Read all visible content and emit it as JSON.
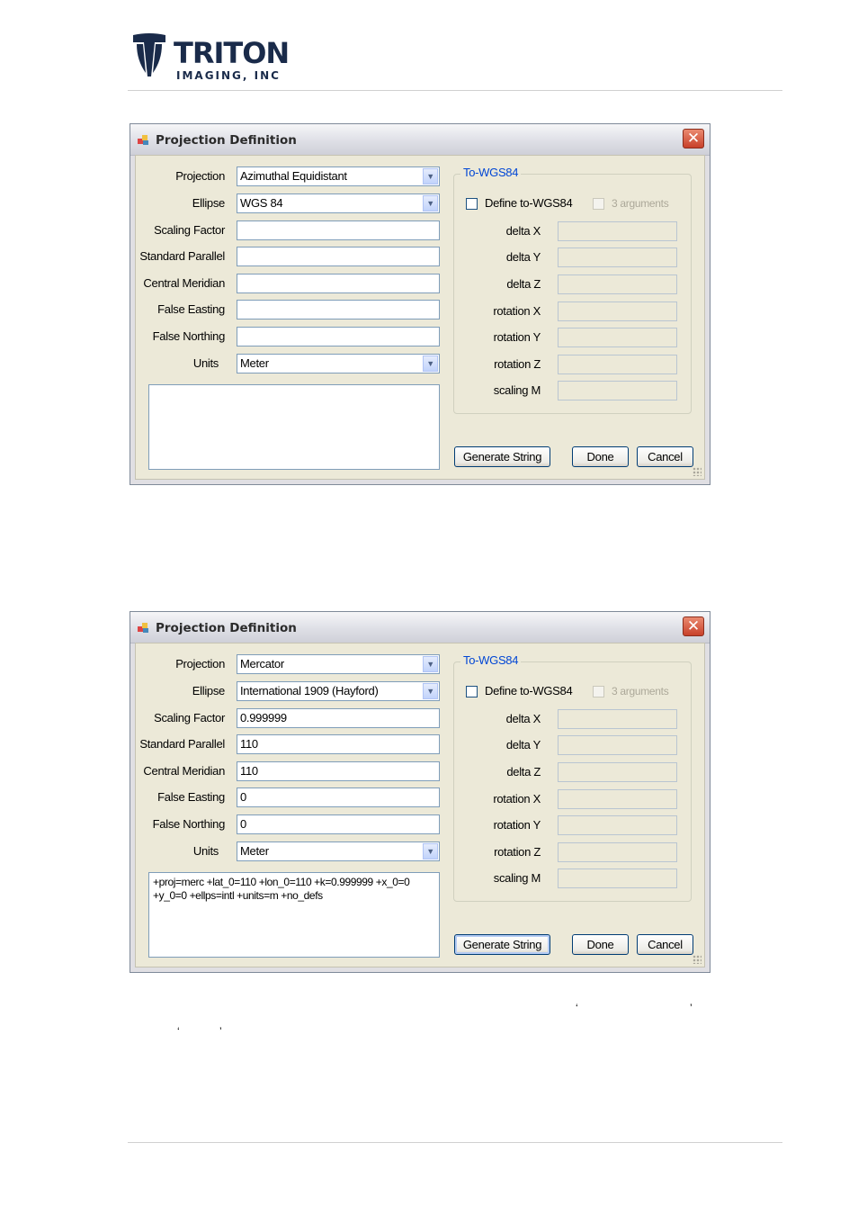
{
  "logo": {
    "name": "TRITON",
    "sub": "IMAGING, INC"
  },
  "dialogs": [
    {
      "title": "Projection Definition",
      "fields": {
        "projection": {
          "label": "Projection",
          "value": "Azimuthal Equidistant"
        },
        "ellipse": {
          "label": "Ellipse",
          "value": "WGS 84"
        },
        "scaling_factor": {
          "label": "Scaling Factor",
          "value": ""
        },
        "standard_parallel": {
          "label": "Standard Parallel",
          "value": ""
        },
        "central_meridian": {
          "label": "Central Meridian",
          "value": ""
        },
        "false_easting": {
          "label": "False Easting",
          "value": ""
        },
        "false_northing": {
          "label": "False Northing",
          "value": ""
        },
        "units": {
          "label": "Units",
          "value": "Meter"
        }
      },
      "output_string": "",
      "towgs84": {
        "group_title": "To-WGS84",
        "define_label": "Define to-WGS84",
        "define_checked": false,
        "args_label": "3 arguments",
        "params": [
          "delta X",
          "delta Y",
          "delta Z",
          "rotation X",
          "rotation Y",
          "rotation Z",
          "scaling M"
        ]
      },
      "buttons": {
        "generate": "Generate String",
        "done": "Done",
        "cancel": "Cancel"
      }
    },
    {
      "title": "Projection Definition",
      "fields": {
        "projection": {
          "label": "Projection",
          "value": "Mercator"
        },
        "ellipse": {
          "label": "Ellipse",
          "value": "International 1909 (Hayford)"
        },
        "scaling_factor": {
          "label": "Scaling Factor",
          "value": "0.999999"
        },
        "standard_parallel": {
          "label": "Standard Parallel",
          "value": "110"
        },
        "central_meridian": {
          "label": "Central Meridian",
          "value": "110"
        },
        "false_easting": {
          "label": "False Easting",
          "value": "0"
        },
        "false_northing": {
          "label": "False Northing",
          "value": "0"
        },
        "units": {
          "label": "Units",
          "value": "Meter"
        }
      },
      "output_string": "+proj=merc +lat_0=110 +lon_0=110 +k=0.999999 +x_0=0 +y_0=0 +ellps=intl +units=m +no_defs",
      "towgs84": {
        "group_title": "To-WGS84",
        "define_label": "Define to-WGS84",
        "define_checked": false,
        "args_label": "3 arguments",
        "params": [
          "delta X",
          "delta Y",
          "delta Z",
          "rotation X",
          "rotation Y",
          "rotation Z",
          "scaling M"
        ]
      },
      "buttons": {
        "generate": "Generate String",
        "done": "Done",
        "cancel": "Cancel"
      }
    }
  ],
  "footer_marks": {
    "q1_open": "‘",
    "q1_close": "’",
    "q2_open": "‘",
    "q2_close": "’"
  }
}
